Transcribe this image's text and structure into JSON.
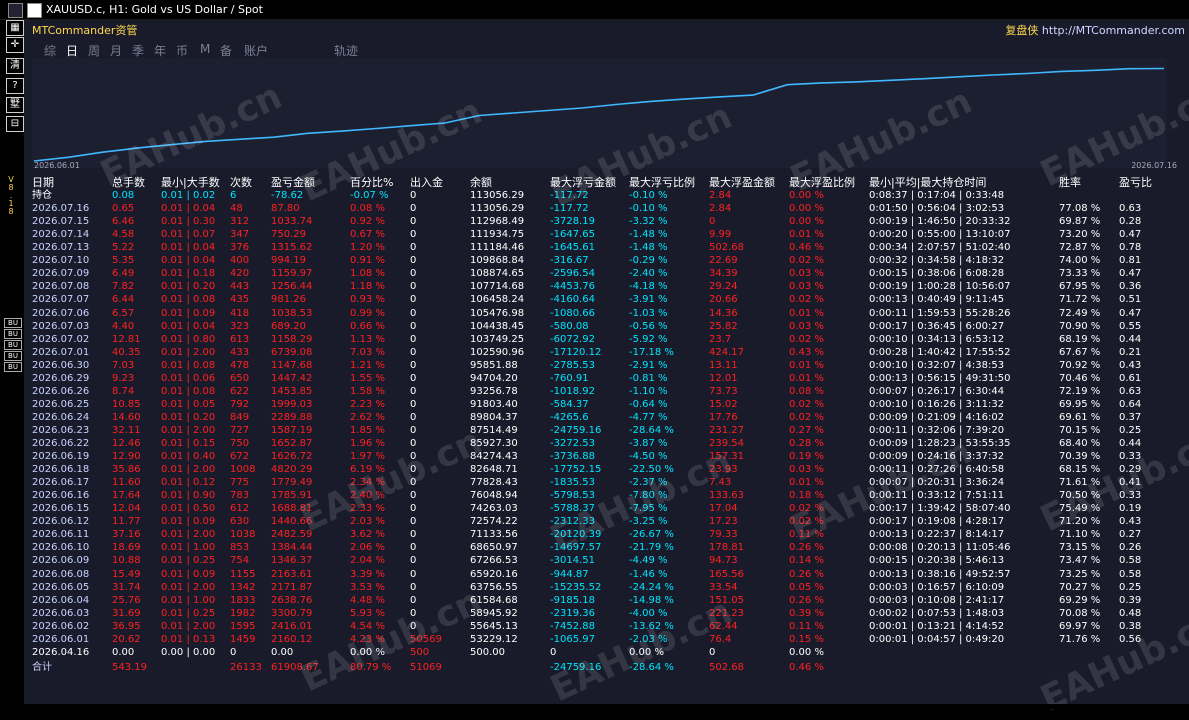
{
  "window": {
    "title": "XAUUSD.c, H1:  Gold vs US Dollar / Spot"
  },
  "brand": {
    "left": "MTCommander资管",
    "right_cn": "复盘侠",
    "right_url": " http://MTCommander.com"
  },
  "tabs": [
    "综",
    "日",
    "周",
    "月",
    "季",
    "年",
    "币",
    "M",
    "备",
    "账户",
    "轨迹"
  ],
  "active_tab": 1,
  "equity_chart": {
    "date_start": "2026.06.01",
    "date_end": "2026.07.16",
    "line_color": "#3fb8ff"
  },
  "side_label": "V8.18",
  "side_buttons": [
    "BU",
    "BU",
    "BU",
    "BU",
    "BU"
  ],
  "left_tools": [
    "▦",
    "✛",
    "清",
    "?",
    "墅",
    "⊟"
  ],
  "columns": [
    "日期",
    "总手数",
    "最小|大手数",
    "次数",
    "盈亏金额",
    "百分比%",
    "出入金",
    "余额",
    "最大浮亏金额",
    "最大浮亏比例",
    "最大浮盈金额",
    "最大浮盈比例",
    "最小|平均|最大持仓时间",
    "胜率",
    "盈亏比"
  ],
  "position_row": [
    "持仓",
    "0.08",
    "0.01 | 0.02",
    "6",
    "-78.62",
    "-0.07 %",
    "0",
    "113056.29",
    "-117.72",
    "-0.10 %",
    "2.84",
    "0.00 %",
    "0:08:37 | 0:17:04 | 0:33:48",
    "",
    ""
  ],
  "rows": [
    [
      "2026.07.16",
      "0.65",
      "0.01 | 0.04",
      "48",
      "87.80",
      "0.08 %",
      "0",
      "113056.29",
      "-117.72",
      "-0.10 %",
      "2.84",
      "0.00 %",
      "0:01:50 | 0:56:04 | 3:02:53",
      "77.08 %",
      "0.63"
    ],
    [
      "2026.07.15",
      "6.46",
      "0.01 | 0.30",
      "312",
      "1033.74",
      "0.92 %",
      "0",
      "112968.49",
      "-3728.19",
      "-3.32 %",
      "0",
      "0.00 %",
      "0:00:19 | 1:46:50 | 20:33:32",
      "69.87 %",
      "0.28"
    ],
    [
      "2026.07.14",
      "4.58",
      "0.01 | 0.07",
      "347",
      "750.29",
      "0.67 %",
      "0",
      "111934.75",
      "-1647.65",
      "-1.48 %",
      "9.99",
      "0.01 %",
      "0:00:20 | 0:55:00 | 13:10:07",
      "73.20 %",
      "0.47"
    ],
    [
      "2026.07.13",
      "5.22",
      "0.01 | 0.04",
      "376",
      "1315.62",
      "1.20 %",
      "0",
      "111184.46",
      "-1645.61",
      "-1.48 %",
      "502.68",
      "0.46 %",
      "0:00:34 | 2:07:57 | 51:02:40",
      "72.87 %",
      "0.78"
    ],
    [
      "2026.07.10",
      "5.35",
      "0.01 | 0.04",
      "400",
      "994.19",
      "0.91 %",
      "0",
      "109868.84",
      "-316.67",
      "-0.29 %",
      "22.69",
      "0.02 %",
      "0:00:32 | 0:34:58 | 4:18:32",
      "74.00 %",
      "0.81"
    ],
    [
      "2026.07.09",
      "6.49",
      "0.01 | 0.18",
      "420",
      "1159.97",
      "1.08 %",
      "0",
      "108874.65",
      "-2596.54",
      "-2.40 %",
      "34.39",
      "0.03 %",
      "0:00:15 | 0:38:06 | 6:08:28",
      "73.33 %",
      "0.47"
    ],
    [
      "2026.07.08",
      "7.82",
      "0.01 | 0.20",
      "443",
      "1256.44",
      "1.18 %",
      "0",
      "107714.68",
      "-4453.76",
      "-4.18 %",
      "29.24",
      "0.03 %",
      "0:00:19 | 1:00:28 | 10:56:07",
      "67.95 %",
      "0.36"
    ],
    [
      "2026.07.07",
      "6.44",
      "0.01 | 0.08",
      "435",
      "981.26",
      "0.93 %",
      "0",
      "106458.24",
      "-4160.64",
      "-3.91 %",
      "20.66",
      "0.02 %",
      "0:00:13 | 0:40:49 | 9:11:45",
      "71.72 %",
      "0.51"
    ],
    [
      "2026.07.06",
      "6.57",
      "0.01 | 0.09",
      "418",
      "1038.53",
      "0.99 %",
      "0",
      "105476.98",
      "-1080.66",
      "-1.03 %",
      "14.36",
      "0.01 %",
      "0:00:11 | 1:59:53 | 55:28:26",
      "72.49 %",
      "0.47"
    ],
    [
      "2026.07.03",
      "4.40",
      "0.01 | 0.04",
      "323",
      "689.20",
      "0.66 %",
      "0",
      "104438.45",
      "-580.08",
      "-0.56 %",
      "25.82",
      "0.03 %",
      "0:00:17 | 0:36:45 | 6:00:27",
      "70.90 %",
      "0.55"
    ],
    [
      "2026.07.02",
      "12.81",
      "0.01 | 0.80",
      "613",
      "1158.29",
      "1.13 %",
      "0",
      "103749.25",
      "-6072.92",
      "-5.92 %",
      "23.7",
      "0.02 %",
      "0:00:10 | 0:34:13 | 6:53:12",
      "68.19 %",
      "0.44"
    ],
    [
      "2026.07.01",
      "40.35",
      "0.01 | 2.00",
      "433",
      "6739.08",
      "7.03 %",
      "0",
      "102590.96",
      "-17120.12",
      "-17.18 %",
      "424.17",
      "0.43 %",
      "0:00:28 | 1:40:42 | 17:55:52",
      "67.67 %",
      "0.21"
    ],
    [
      "2026.06.30",
      "7.03",
      "0.01 | 0.08",
      "478",
      "1147.68",
      "1.21 %",
      "0",
      "95851.88",
      "-2785.53",
      "-2.91 %",
      "13.11",
      "0.01 %",
      "0:00:10 | 0:32:07 | 4:38:53",
      "70.92 %",
      "0.43"
    ],
    [
      "2026.06.29",
      "9.23",
      "0.01 | 0.06",
      "650",
      "1447.42",
      "1.55 %",
      "0",
      "94704.20",
      "-760.91",
      "-0.81 %",
      "12.01",
      "0.01 %",
      "0:00:13 | 0:56:15 | 49:31:50",
      "70.46 %",
      "0.61"
    ],
    [
      "2026.06.26",
      "8.74",
      "0.01 | 0.08",
      "622",
      "1453.85",
      "1.58 %",
      "0",
      "93256.78",
      "-1018.92",
      "-1.10 %",
      "73.73",
      "0.08 %",
      "0:00:07 | 0:26:17 | 6:30:44",
      "72.19 %",
      "0.63"
    ],
    [
      "2026.06.25",
      "10.85",
      "0.01 | 0.05",
      "792",
      "1999.03",
      "2.23 %",
      "0",
      "91803.40",
      "-584.37",
      "-0.64 %",
      "15.02",
      "0.02 %",
      "0:00:10 | 0:16:26 | 3:11:32",
      "69.95 %",
      "0.64"
    ],
    [
      "2026.06.24",
      "14.60",
      "0.01 | 0.20",
      "849",
      "2289.88",
      "2.62 %",
      "0",
      "89804.37",
      "-4265.6",
      "-4.77 %",
      "17.76",
      "0.02 %",
      "0:00:09 | 0:21:09 | 4:16:02",
      "69.61 %",
      "0.37"
    ],
    [
      "2026.06.23",
      "32.11",
      "0.01 | 2.00",
      "727",
      "1587.19",
      "1.85 %",
      "0",
      "87514.49",
      "-24759.16",
      "-28.64 %",
      "231.27",
      "0.27 %",
      "0:00:11 | 0:32:06 | 7:39:20",
      "70.15 %",
      "0.25"
    ],
    [
      "2026.06.22",
      "12.46",
      "0.01 | 0.15",
      "750",
      "1652.87",
      "1.96 %",
      "0",
      "85927.30",
      "-3272.53",
      "-3.87 %",
      "239.54",
      "0.28 %",
      "0:00:09 | 1:28:23 | 53:55:35",
      "68.40 %",
      "0.44"
    ],
    [
      "2026.06.19",
      "12.90",
      "0.01 | 0.40",
      "672",
      "1626.72",
      "1.97 %",
      "0",
      "84274.43",
      "-3736.88",
      "-4.50 %",
      "157.31",
      "0.19 %",
      "0:00:09 | 0:24:16 | 3:37:32",
      "70.39 %",
      "0.33"
    ],
    [
      "2026.06.18",
      "35.86",
      "0.01 | 2.00",
      "1008",
      "4820.29",
      "6.19 %",
      "0",
      "82648.71",
      "-17752.15",
      "-22.50 %",
      "23.93",
      "0.03 %",
      "0:00:11 | 0:27:26 | 6:40:58",
      "68.15 %",
      "0.29"
    ],
    [
      "2026.06.17",
      "11.60",
      "0.01 | 0.12",
      "775",
      "1779.49",
      "2.34 %",
      "0",
      "77828.43",
      "-1835.53",
      "-2.37 %",
      "7.43",
      "0.01 %",
      "0:00:07 | 0:20:31 | 3:36:24",
      "71.61 %",
      "0.41"
    ],
    [
      "2026.06.16",
      "17.64",
      "0.01 | 0.90",
      "783",
      "1785.91",
      "2.40 %",
      "0",
      "76048.94",
      "-5798.53",
      "-7.80 %",
      "133.63",
      "0.18 %",
      "0:00:11 | 0:33:12 | 7:51:11",
      "70.50 %",
      "0.33"
    ],
    [
      "2026.06.15",
      "12.04",
      "0.01 | 0.50",
      "612",
      "1688.81",
      "2.33 %",
      "0",
      "74263.03",
      "-5788.37",
      "-7.95 %",
      "17.04",
      "0.02 %",
      "0:00:17 | 1:39:42 | 58:07:40",
      "75.49 %",
      "0.19"
    ],
    [
      "2026.06.12",
      "11.77",
      "0.01 | 0.09",
      "630",
      "1440.66",
      "2.03 %",
      "0",
      "72574.22",
      "-2312.33",
      "-3.25 %",
      "17.23",
      "0.02 %",
      "0:00:17 | 0:19:08 | 4:28:17",
      "71.20 %",
      "0.43"
    ],
    [
      "2026.06.11",
      "37.16",
      "0.01 | 2.00",
      "1038",
      "2482.59",
      "3.62 %",
      "0",
      "71133.56",
      "-20120.39",
      "-26.67 %",
      "79.33",
      "0.11 %",
      "0:00:13 | 0:22:37 | 8:14:17",
      "71.10 %",
      "0.27"
    ],
    [
      "2026.06.10",
      "18.69",
      "0.01 | 1.00",
      "853",
      "1384.44",
      "2.06 %",
      "0",
      "68650.97",
      "-14697.57",
      "-21.79 %",
      "178.81",
      "0.26 %",
      "0:00:08 | 0:20:13 | 11:05:46",
      "73.15 %",
      "0.26"
    ],
    [
      "2026.06.09",
      "10.88",
      "0.01 | 0.25",
      "754",
      "1346.37",
      "2.04 %",
      "0",
      "67266.53",
      "-3014.51",
      "-4.49 %",
      "94.73",
      "0.14 %",
      "0:00:15 | 0:20:38 | 5:46:13",
      "73.47 %",
      "0.58"
    ],
    [
      "2026.06.08",
      "15.49",
      "0.01 | 0.09",
      "1155",
      "2163.61",
      "3.39 %",
      "0",
      "65920.16",
      "-944.87",
      "-1.46 %",
      "165.56",
      "0.26 %",
      "0:00:13 | 0:38:16 | 49:52:57",
      "73.25 %",
      "0.58"
    ],
    [
      "2026.06.05",
      "31.74",
      "0.01 | 2.00",
      "1342",
      "2171.87",
      "3.53 %",
      "0",
      "63756.55",
      "-15235.52",
      "-24.24 %",
      "33.54",
      "0.05 %",
      "0:00:03 | 0:16:57 | 6:10:09",
      "70.27 %",
      "0.25"
    ],
    [
      "2026.06.04",
      "25.76",
      "0.01 | 1.00",
      "1833",
      "2638.76",
      "4.48 %",
      "0",
      "61584.68",
      "-9185.18",
      "-14.98 %",
      "151.05",
      "0.26 %",
      "0:00:03 | 0:10:08 | 2:41:17",
      "69.29 %",
      "0.39"
    ],
    [
      "2026.06.03",
      "31.69",
      "0.01 | 0.25",
      "1982",
      "3300.79",
      "5.93 %",
      "0",
      "58945.92",
      "-2319.36",
      "-4.00 %",
      "221.23",
      "0.39 %",
      "0:00:02 | 0:07:53 | 1:48:03",
      "70.08 %",
      "0.48"
    ],
    [
      "2026.06.02",
      "36.95",
      "0.01 | 2.00",
      "1595",
      "2416.01",
      "4.54 %",
      "0",
      "55645.13",
      "-7452.88",
      "-13.62 %",
      "62.44",
      "0.11 %",
      "0:00:01 | 0:13:21 | 4:14:52",
      "69.97 %",
      "0.38"
    ],
    [
      "2026.06.01",
      "20.62",
      "0.01 | 0.13",
      "1459",
      "2160.12",
      "4.23 %",
      "50569",
      "53229.12",
      "-1065.97",
      "-2.03 %",
      "76.4",
      "0.15 %",
      "0:00:01 | 0:04:57 | 0:49:20",
      "71.76 %",
      "0.56"
    ],
    [
      "2026.04.16",
      "0.00",
      "0.00 | 0.00",
      "0",
      "0.00",
      "0.00 %",
      "500",
      "500.00",
      "0",
      "0.00 %",
      "0",
      "0.00 %",
      "",
      "",
      ""
    ]
  ],
  "total_row": [
    "合计",
    "543.19",
    "",
    "26133",
    "61908.67",
    "80.79 %",
    "51069",
    "",
    "-24759.16",
    "-28.64 %",
    "502.68",
    "0.46 %",
    "",
    "",
    ""
  ],
  "watermark": "EAHub.cn"
}
